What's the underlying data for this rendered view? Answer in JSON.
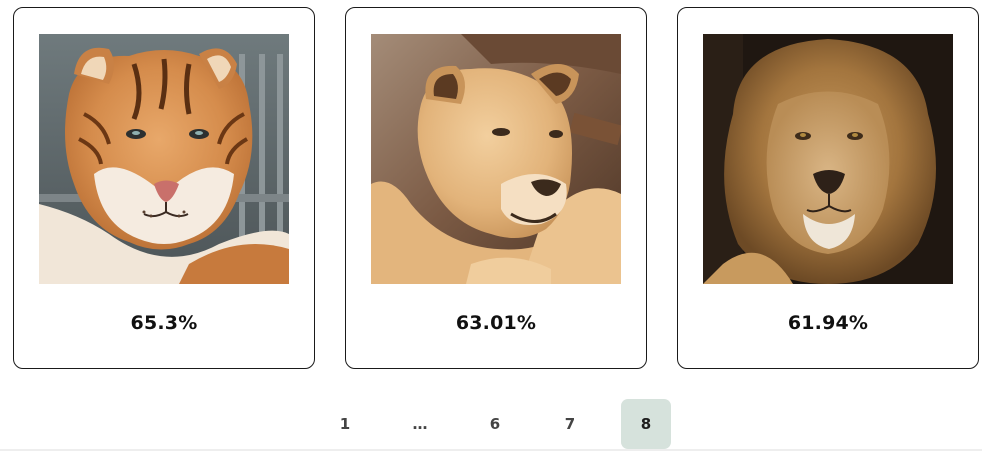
{
  "results": [
    {
      "image_subject": "tiger",
      "score": "65.3%"
    },
    {
      "image_subject": "lioness",
      "score": "63.01%"
    },
    {
      "image_subject": "lion",
      "score": "61.94%"
    }
  ],
  "pagination": {
    "pages": [
      "1",
      "…",
      "6",
      "7",
      "8"
    ],
    "current": "8"
  },
  "colors": {
    "card_border": "#1a1a1a",
    "active_page_bg": "#d6e2dc",
    "page_text": "#444444"
  }
}
